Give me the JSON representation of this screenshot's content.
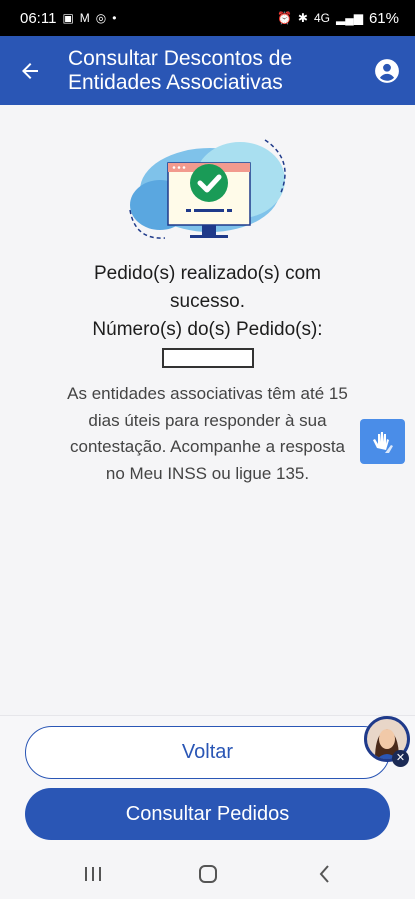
{
  "status_bar": {
    "time": "06:11",
    "network": "4G",
    "battery": "61%"
  },
  "app_bar": {
    "title": "Consultar Descontos de Entidades Associativas",
    "back_icon": "arrow-left-icon",
    "profile_icon": "account-circle-icon"
  },
  "main": {
    "success_line1": "Pedido(s) realizado(s) com",
    "success_line2": "sucesso.",
    "order_label": "Número(s) do(s) Pedido(s):",
    "order_value": "",
    "info_text": "As entidades associativas têm até 15 dias úteis para responder à sua contestação. Acompanhe a resposta no Meu INSS ou ligue 135."
  },
  "accessibility": {
    "libras_icon": "sign-language-icon"
  },
  "actions": {
    "voltar_label": "Voltar",
    "consultar_label": "Consultar Pedidos"
  },
  "colors": {
    "primary": "#2a56b5",
    "accent": "#4a8de8",
    "success": "#1a9b57"
  }
}
